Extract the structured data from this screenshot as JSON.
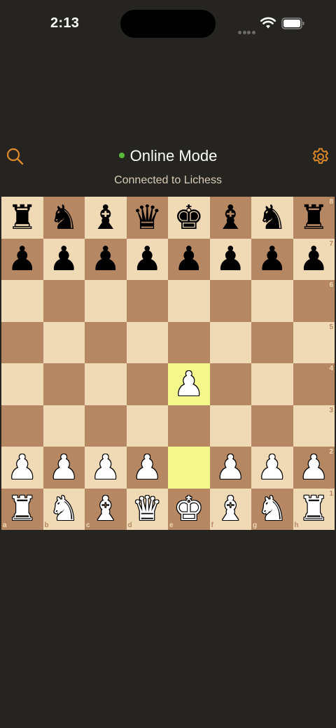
{
  "status_bar": {
    "time": "2:13"
  },
  "header": {
    "title": "Online Mode",
    "subtitle": "Connected to Lichess",
    "status_color": "#5cb83b",
    "accent_color": "#e0892a",
    "search_icon": "search-icon",
    "settings_icon": "gear-icon"
  },
  "board": {
    "light_color": "#f0d9b5",
    "dark_color": "#b58863",
    "highlight_color": "#f4f78a",
    "highlighted_squares": [
      "e2",
      "e4"
    ],
    "files": [
      "a",
      "b",
      "c",
      "d",
      "e",
      "f",
      "g",
      "h"
    ],
    "ranks": [
      "8",
      "7",
      "6",
      "5",
      "4",
      "3",
      "2",
      "1"
    ],
    "rows": [
      [
        "r",
        "n",
        "b",
        "q",
        "k",
        "b",
        "n",
        "r"
      ],
      [
        "p",
        "p",
        "p",
        "p",
        "p",
        "p",
        "p",
        "p"
      ],
      [
        "",
        "",
        "",
        "",
        "",
        "",
        "",
        ""
      ],
      [
        "",
        "",
        "",
        "",
        "",
        "",
        "",
        ""
      ],
      [
        "",
        "",
        "",
        "",
        "P",
        "",
        "",
        ""
      ],
      [
        "",
        "",
        "",
        "",
        "",
        "",
        "",
        ""
      ],
      [
        "P",
        "P",
        "P",
        "P",
        "",
        "P",
        "P",
        "P"
      ],
      [
        "R",
        "N",
        "B",
        "Q",
        "K",
        "B",
        "N",
        "R"
      ]
    ]
  }
}
